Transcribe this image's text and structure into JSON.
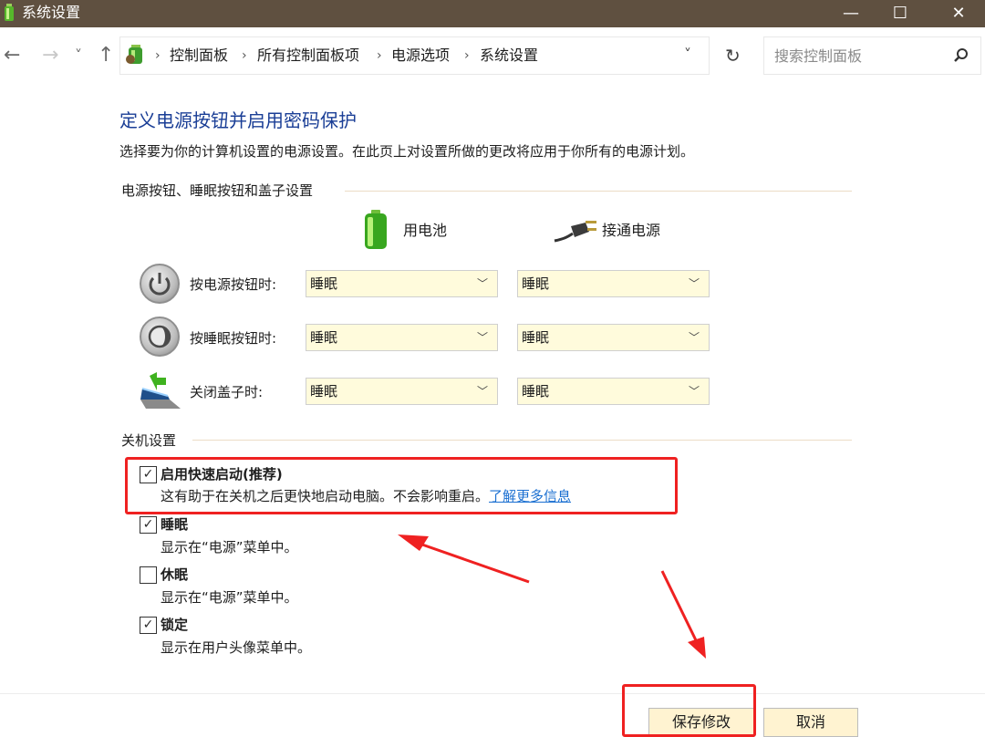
{
  "window": {
    "title": "系统设置",
    "minimize_glyph": "—",
    "maximize_glyph": "☐",
    "close_glyph": "✕"
  },
  "nav": {
    "back_glyph": "←",
    "forward_glyph": "→",
    "recent_glyph": "˅",
    "up_glyph": "↑",
    "breadcrumbs": [
      "控制面板",
      "所有控制面板项",
      "电源选项",
      "系统设置"
    ],
    "separator": "›",
    "dropdown_glyph": "˅",
    "refresh_glyph": "↻",
    "search_placeholder": "搜索控制面板",
    "search_glyph": "⚲"
  },
  "page": {
    "heading": "定义电源按钮并启用密码保护",
    "description": "选择要为你的计算机设置的电源设置。在此页上对设置所做的更改将应用于你所有的电源计划。"
  },
  "buttons_section": {
    "label": "电源按钮、睡眠按钮和盖子设置",
    "col_battery": "用电池",
    "col_plugged": "接通电源",
    "rows": [
      {
        "label": "按电源按钮时:",
        "battery": "睡眠",
        "plugged": "睡眠"
      },
      {
        "label": "按睡眠按钮时:",
        "battery": "睡眠",
        "plugged": "睡眠"
      },
      {
        "label": "关闭盖子时:",
        "battery": "睡眠",
        "plugged": "睡眠"
      }
    ],
    "chevron_glyph": "﹀"
  },
  "shutdown_section": {
    "label": "关机设置",
    "items": [
      {
        "title": "启用快速启动(推荐)",
        "desc": "这有助于在关机之后更快地启动电脑。不会影响重启。",
        "link": "了解更多信息",
        "checked": true
      },
      {
        "title": "睡眠",
        "desc": "显示在“电源”菜单中。",
        "checked": true
      },
      {
        "title": "休眠",
        "desc": "显示在“电源”菜单中。",
        "checked": false
      },
      {
        "title": "锁定",
        "desc": "显示在用户头像菜单中。",
        "checked": true
      }
    ],
    "check_glyph": "✓"
  },
  "footer": {
    "save_label": "保存修改",
    "cancel_label": "取消"
  },
  "colors": {
    "titlebar": "#5f5040",
    "heading": "#1a3e96",
    "dropdown_bg": "#fffbdc",
    "button_bg": "#fff3d1",
    "annotation_red": "#ef2121",
    "link": "#1a6fd1"
  }
}
